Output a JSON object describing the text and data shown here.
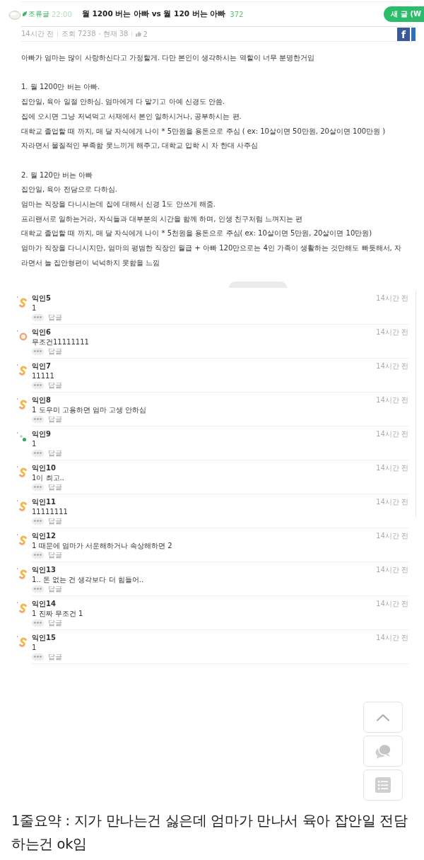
{
  "header": {
    "category": "조류글",
    "category_note": "22:00",
    "title": "월 1200 버는 아빠 vs 월 120 버는 아빠",
    "comment_count": "372",
    "new_post_button": "새 글 (W"
  },
  "meta": {
    "time": "14시간 전",
    "views": "조회 7238",
    "scraps": "현재 38",
    "likes": "2",
    "share_buttons": [
      {
        "kind": "facebook",
        "label": "f"
      },
      {
        "kind": "partial"
      }
    ]
  },
  "body": {
    "sections": [
      {
        "lines": [
          "아빠가 엄마는 많이 사랑하신다고 가정할게. 다만 본인이 생각하시는 역할이 너무 분명한거임"
        ]
      },
      {
        "lines": [
          "1. 월 1200만 버는 아빠.",
          "집안일, 육아 일절 안하심. 엄마에게 다 맡기고 아예 신경도 안씀.",
          "집에 오시면 그냥 저녁먹고 서재에서 본인 일하시거나, 공부하시는 편.",
          "대학교 졸업할 때 까지, 매 달 자식에게 나이 * 5만원을 용돈으로 주심 ( ex: 10살이면 50만원, 20살이면 100만원 )",
          "자라면서 물질적인 부족함 못느끼게 해주고, 대학교 입학 시 차 한대 사주심"
        ]
      },
      {
        "lines": [
          "2. 월 120만 버는 아빠",
          "집안일, 육아 전담으로 다하심.",
          "엄마는 직장을 다니시는데 집에 대해서 신경 1도 안쓰게 해줌.",
          "프리랜서로 일하는거라, 자식들과 대부분의 시간을 함께 하며, 인생 친구처럼 느껴지는 편",
          "대학교 졸업할 때 까지, 매 달 자식에게 나이 * 5천원을 용돈으로 주심( ex: 10살이면 5만원, 20살이면 10만원)",
          "엄마가 직장을 다니시지만, 엄마의 평범한 직장인 월급 + 아빠 120만으로는 4인 가족이 생활하는 것만해도 빠듯해서, 자라면서 늘 집안형편이 넉넉하지 못함을 느낌"
        ]
      }
    ]
  },
  "comments": [
    {
      "author": "익인5",
      "time": "14시간 전",
      "text": "1",
      "reply": "답글",
      "avatar": {
        "kind": "swirl"
      }
    },
    {
      "author": "익인6",
      "time": "14시간 전",
      "text": "무조건11111111",
      "reply": "답글",
      "avatar": {
        "kind": "ring"
      }
    },
    {
      "author": "익인7",
      "time": "14시간 전",
      "text": "11111",
      "reply": "답글",
      "avatar": {
        "kind": "swirl"
      }
    },
    {
      "author": "익인8",
      "time": "14시간 전",
      "text": "1 도우미 고용하면 엄마 고생 안하심",
      "reply": "답글",
      "avatar": {
        "kind": "swirl"
      }
    },
    {
      "author": "익인9",
      "time": "14시간 전",
      "text": "1",
      "reply": "답글",
      "avatar": {
        "kind": "dots"
      }
    },
    {
      "author": "익인10",
      "time": "14시간 전",
      "text": "1이 최고..",
      "reply": "답글",
      "avatar": {
        "kind": "swirl"
      }
    },
    {
      "author": "익인11",
      "time": "14시간 전",
      "text": "11111111",
      "reply": "답글",
      "avatar": {
        "kind": "swirl"
      }
    },
    {
      "author": "익인12",
      "time": "14시간 전",
      "text": "1 때문에 엄마가 서운해하거나 속상해하면 2",
      "reply": "답글",
      "avatar": {
        "kind": "swirl"
      }
    },
    {
      "author": "익인13",
      "time": "14시간 전",
      "text": "1.. 돈 없는 건 생각보다 더 힘들어..",
      "reply": "답글",
      "avatar": {
        "kind": "swirl"
      }
    },
    {
      "author": "익인14",
      "time": "14시간 전",
      "text": "1 진짜 무조건 1",
      "reply": "답글",
      "avatar": {
        "kind": "swirl"
      }
    },
    {
      "author": "익인15",
      "time": "14시간 전",
      "text": "1",
      "reply": "답글",
      "avatar": {
        "kind": "swirl"
      }
    }
  ],
  "floating_buttons": [
    {
      "kind": "up"
    },
    {
      "kind": "chat"
    },
    {
      "kind": "list"
    }
  ],
  "summary": "1줄요약 : 지가 만나는건 싫은데 엄마가 만나서 육아 잡안일 전담하는건 ok임"
}
